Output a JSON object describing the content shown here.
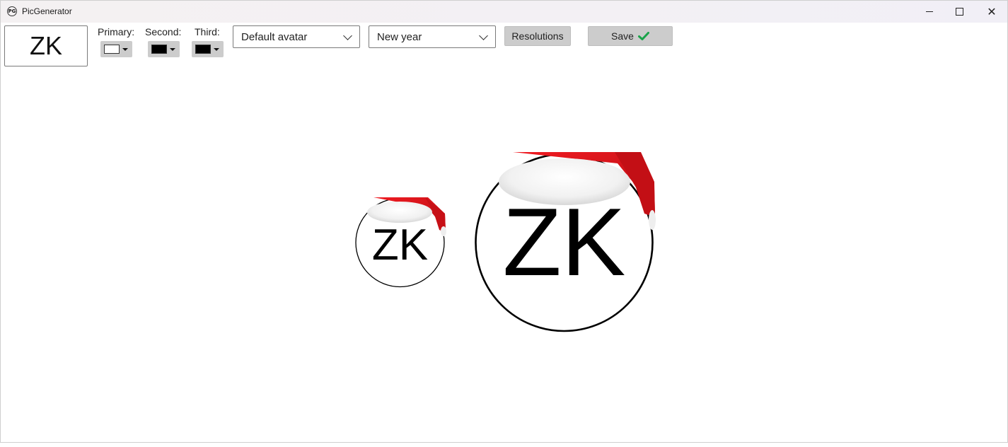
{
  "window": {
    "title": "PicGenerator",
    "icon_text": "PG",
    "close_glyph": "✕"
  },
  "toolbar": {
    "initials": "ZK",
    "primary_label": "Primary:",
    "second_label": "Second:",
    "third_label": "Third:",
    "colors": {
      "primary": "#ffffff",
      "second": "#000000",
      "third": "#000000"
    },
    "template_select": {
      "value": "Default avatar"
    },
    "theme_select": {
      "value": "New year"
    },
    "resolutions_label": "Resolutions",
    "save_label": "Save"
  },
  "preview": {
    "small_initials": "ZK",
    "large_initials": "ZK",
    "hat_colors": {
      "red": "#e0121a",
      "fur": "#f3f3f3"
    },
    "circle_fill": "#ffffff",
    "circle_stroke": "#000000"
  },
  "accent": {
    "check": "#1aa34a"
  }
}
